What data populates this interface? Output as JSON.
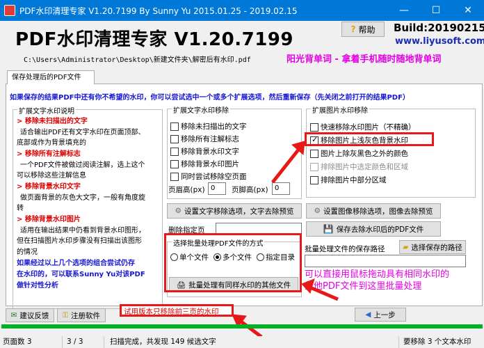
{
  "window": {
    "title": "PDF水印清理专家 V1.20.7199 By Sunny Yu 2015.01.25 - 2019.02.15",
    "minimize": "—",
    "maximize": "☐",
    "close": "✕"
  },
  "header": {
    "brand": "PDF水印清理专家 V1.20.7199",
    "path": "C:\\Users\\Administrator\\Desktop\\新建文件夹\\解密后有水印.pdf",
    "help_label": "帮助",
    "build": "Build:20190215",
    "site": "www.liyusoft.com",
    "slogan": "阳光背单词 - 拿着手机随时随地背单词"
  },
  "tabs": [
    {
      "label": "保存处理后的PDF文件"
    }
  ],
  "info_text": "如果保存的结果PDF中还有你不希望的水印，你可以尝试选中一个或多个扩展选项，然后重新保存（先关闭之前打开的结果PDF）",
  "desc_group": {
    "title": "扩展文字水印说明",
    "lines": [
      "> 移除未扫描出的文字",
      "适合输出PDF还有文字水印在页面顶部、",
      "底部或作为背景填充的",
      "> 移除所有注解标志",
      "一个PDF文件被做过阅读注解，选上这个",
      "可以移除这些注解信息",
      "> 移除背景水印文字",
      "做页面背景的灰色大文字，一般有角度旋",
      "转",
      "> 移除背景水印图片",
      "适用在输出结果中仍看到背景水印图形，",
      "但在扫描图片水印步骤没有扫描出该图形",
      "的情况",
      "如果经过以上几个选项的组合尝试仍存",
      "在水印的，可以联系Sunny Yu对该PDF",
      "做针对性分析"
    ]
  },
  "text_group": {
    "title": "扩展文字水印移除",
    "options": [
      {
        "label": "移除未扫描出的文字",
        "checked": false
      },
      {
        "label": "移除所有注解标志",
        "checked": false
      },
      {
        "label": "移除背景水印文字",
        "checked": false
      },
      {
        "label": "移除背景水印图片",
        "checked": false
      },
      {
        "label": "同时尝试移除空页面",
        "checked": false
      }
    ],
    "header_label": "页眉高(px)",
    "header_value": "0",
    "footer_label": "页脚高(px)",
    "footer_value": "0",
    "preview_button": "设置文字移除选项，文字去除预览",
    "delete_pages_label": "删除指定页"
  },
  "img_group": {
    "title": "扩展图片水印移除",
    "options": [
      {
        "label": "快速移除水印图片（不精确）",
        "checked": false,
        "enabled": true
      },
      {
        "label": "移除图片上浅灰色背景水印",
        "checked": true,
        "enabled": true
      },
      {
        "label": "图片上除灰黑色之外的颜色",
        "checked": false,
        "enabled": true
      },
      {
        "label": "排除图片中选定颜色和区域",
        "checked": false,
        "enabled": false
      },
      {
        "label": "排除图片中部分区域",
        "checked": false,
        "enabled": true
      }
    ],
    "preview_button": "设置图像移除选项，图像去除预览",
    "save_button": "保存去除水印后的PDF文件"
  },
  "batch": {
    "title": "选择批量处理PDF文件的方式",
    "modes": [
      {
        "label": "单个文件",
        "selected": false
      },
      {
        "label": "多个文件",
        "selected": true
      },
      {
        "label": "指定目录",
        "selected": false
      }
    ],
    "process_button": "批量处理有同样水印的其他文件",
    "save_path_label": "批量处理文件的保存路径",
    "choose_path_button": "选择保存的路径"
  },
  "note": [
    "可以直接用鼠标拖动具有相同水印的",
    "其他PDF文件到这里批量处理"
  ],
  "footer": {
    "feedback_button": "建议反馈",
    "register_button": "注册软件",
    "trial_notice": "试用版本只移除前三页的水印",
    "prev_button": "上一步"
  },
  "progress": 1.0,
  "status": {
    "pages_label": "页面数 3",
    "page_index": "3 / 3",
    "scan_result": "扫描完成，共发现 149 候选文字",
    "removal": "要移除 3 个文本水印"
  },
  "colors": {
    "titlebar": "#0078d7",
    "info_blue": "#1515d6",
    "accent_red": "#e00000",
    "slogan_magenta": "#e400e4",
    "progress_green": "#06b025"
  }
}
